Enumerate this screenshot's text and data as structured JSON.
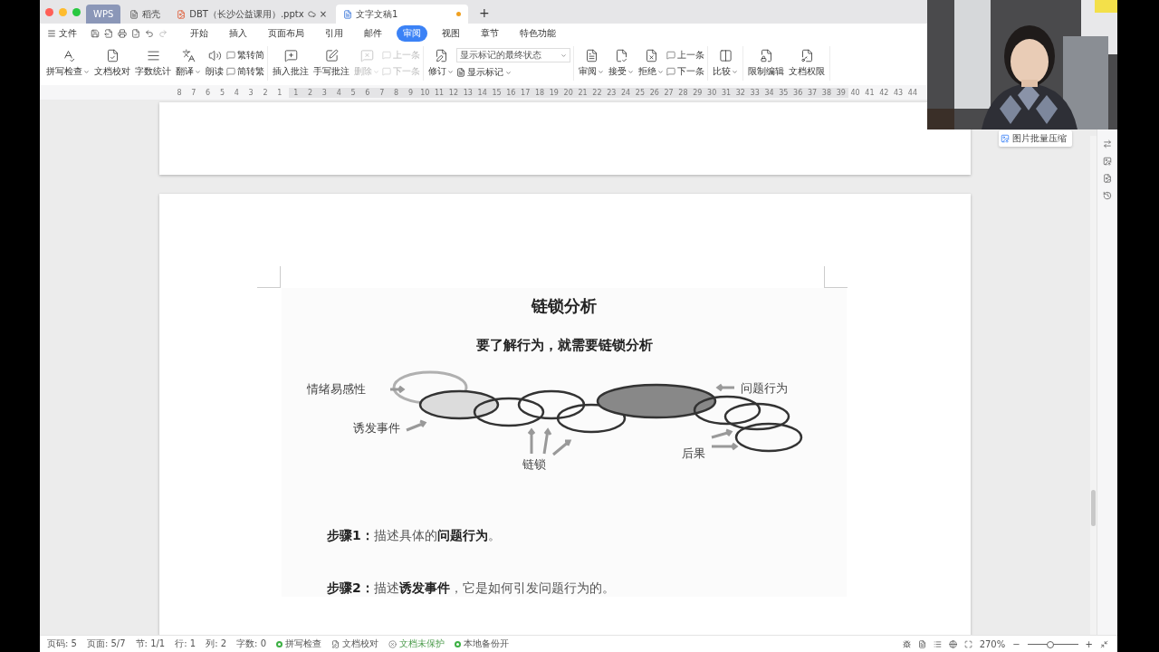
{
  "window_tabs": [
    {
      "label": "WPS",
      "kind": "home",
      "selected": false,
      "unsaved": false
    },
    {
      "label": "稻壳",
      "kind": "store",
      "selected": false,
      "unsaved": false
    },
    {
      "label": "DBT（长沙公益课用）.pptx",
      "kind": "slides",
      "selected": false,
      "unsaved": false,
      "close": "×"
    },
    {
      "label": "文字文稿1",
      "kind": "writer",
      "selected": true,
      "unsaved": true
    }
  ],
  "new_tab": "+",
  "menu": {
    "file": "文件",
    "tabs": [
      {
        "label": "开始",
        "selected": false
      },
      {
        "label": "插入",
        "selected": false
      },
      {
        "label": "页面布局",
        "selected": false
      },
      {
        "label": "引用",
        "selected": false
      },
      {
        "label": "邮件",
        "selected": false
      },
      {
        "label": "审阅",
        "selected": true
      },
      {
        "label": "视图",
        "selected": false
      },
      {
        "label": "章节",
        "selected": false
      },
      {
        "label": "特色功能",
        "selected": false
      }
    ]
  },
  "toolbar": [
    [
      {
        "kind": "big",
        "label": "拼写检查",
        "dropdown": true,
        "disabled": false
      },
      {
        "kind": "big",
        "label": "文档校对",
        "dropdown": false,
        "disabled": false
      },
      {
        "kind": "big",
        "label": "字数统计",
        "dropdown": false,
        "disabled": false
      },
      {
        "kind": "big",
        "label": "翻译",
        "dropdown": true,
        "disabled": false
      },
      {
        "kind": "big",
        "label": "朗读",
        "dropdown": false,
        "disabled": false
      },
      {
        "kind": "pair",
        "items": [
          {
            "label": "繁转简",
            "disabled": false
          },
          {
            "label": "简转繁",
            "disabled": false
          }
        ]
      }
    ],
    [
      {
        "kind": "big",
        "label": "插入批注",
        "dropdown": false,
        "disabled": false
      },
      {
        "kind": "big",
        "label": "手写批注",
        "dropdown": false,
        "disabled": false
      },
      {
        "kind": "big",
        "label": "删除",
        "dropdown": true,
        "disabled": true
      },
      {
        "kind": "pair",
        "items": [
          {
            "label": "上一条",
            "disabled": true
          },
          {
            "label": "下一条",
            "disabled": true
          }
        ]
      }
    ],
    [
      {
        "kind": "big",
        "label": "修订",
        "dropdown": true,
        "disabled": false
      },
      {
        "kind": "select",
        "value": "显示标记的最终状态",
        "below": "显示标记"
      }
    ],
    [
      {
        "kind": "big",
        "label": "审阅",
        "dropdown": true,
        "disabled": false
      },
      {
        "kind": "big",
        "label": "接受",
        "dropdown": true,
        "disabled": false
      },
      {
        "kind": "big",
        "label": "拒绝",
        "dropdown": true,
        "disabled": false
      },
      {
        "kind": "pair",
        "items": [
          {
            "label": "上一条",
            "disabled": false
          },
          {
            "label": "下一条",
            "disabled": false
          }
        ]
      }
    ],
    [
      {
        "kind": "big",
        "label": "比较",
        "dropdown": true,
        "disabled": false
      }
    ],
    [
      {
        "kind": "big",
        "label": "限制编辑",
        "dropdown": false,
        "disabled": false
      },
      {
        "kind": "big",
        "label": "文档权限",
        "dropdown": false,
        "disabled": false
      }
    ]
  ],
  "ruler": {
    "left_numbers": [
      "8",
      "7",
      "6",
      "5",
      "4",
      "3",
      "2",
      "1"
    ],
    "text_numbers": [
      "1",
      "2",
      "3",
      "4",
      "5",
      "6",
      "7",
      "8",
      "9",
      "10",
      "11",
      "12",
      "13",
      "14",
      "15",
      "16",
      "17",
      "18",
      "19",
      "20",
      "21",
      "22",
      "23",
      "24",
      "25",
      "26",
      "27",
      "28",
      "29",
      "30",
      "31",
      "32",
      "33",
      "34",
      "35",
      "36",
      "37",
      "38",
      "39"
    ],
    "right_numbers": [
      "40",
      "41",
      "42",
      "43",
      "44"
    ]
  },
  "document": {
    "title": "链锁分析",
    "subtitle": "要了解行为，就需要链锁分析",
    "diagram_labels": [
      "情绪易感性",
      "诱发事件",
      "链锁",
      "问题行为",
      "后果"
    ],
    "steps": [
      "**步骤1：**描述具体的**问题行为**。",
      "**步骤2：**描述**诱发事件**，它是如何引发问题行为的。"
    ]
  },
  "side_chip": "图片批量压缩",
  "status_bar": {
    "fields": [
      "页码: 5",
      "页面: 5/7",
      "节: 1/1",
      "行: 1",
      "列: 2",
      "字数: 0"
    ],
    "checks": [
      {
        "label": "拼写检查",
        "kind": "on"
      },
      {
        "label": "文档校对",
        "kind": "proof"
      },
      {
        "label": "文档未保护",
        "kind": "unprotected"
      },
      {
        "label": "本地备份开",
        "kind": "on"
      }
    ],
    "zoom": "270%",
    "zoom_out": "−",
    "zoom_in": "+",
    "zoom_slider": {
      "level": 0.45
    }
  }
}
